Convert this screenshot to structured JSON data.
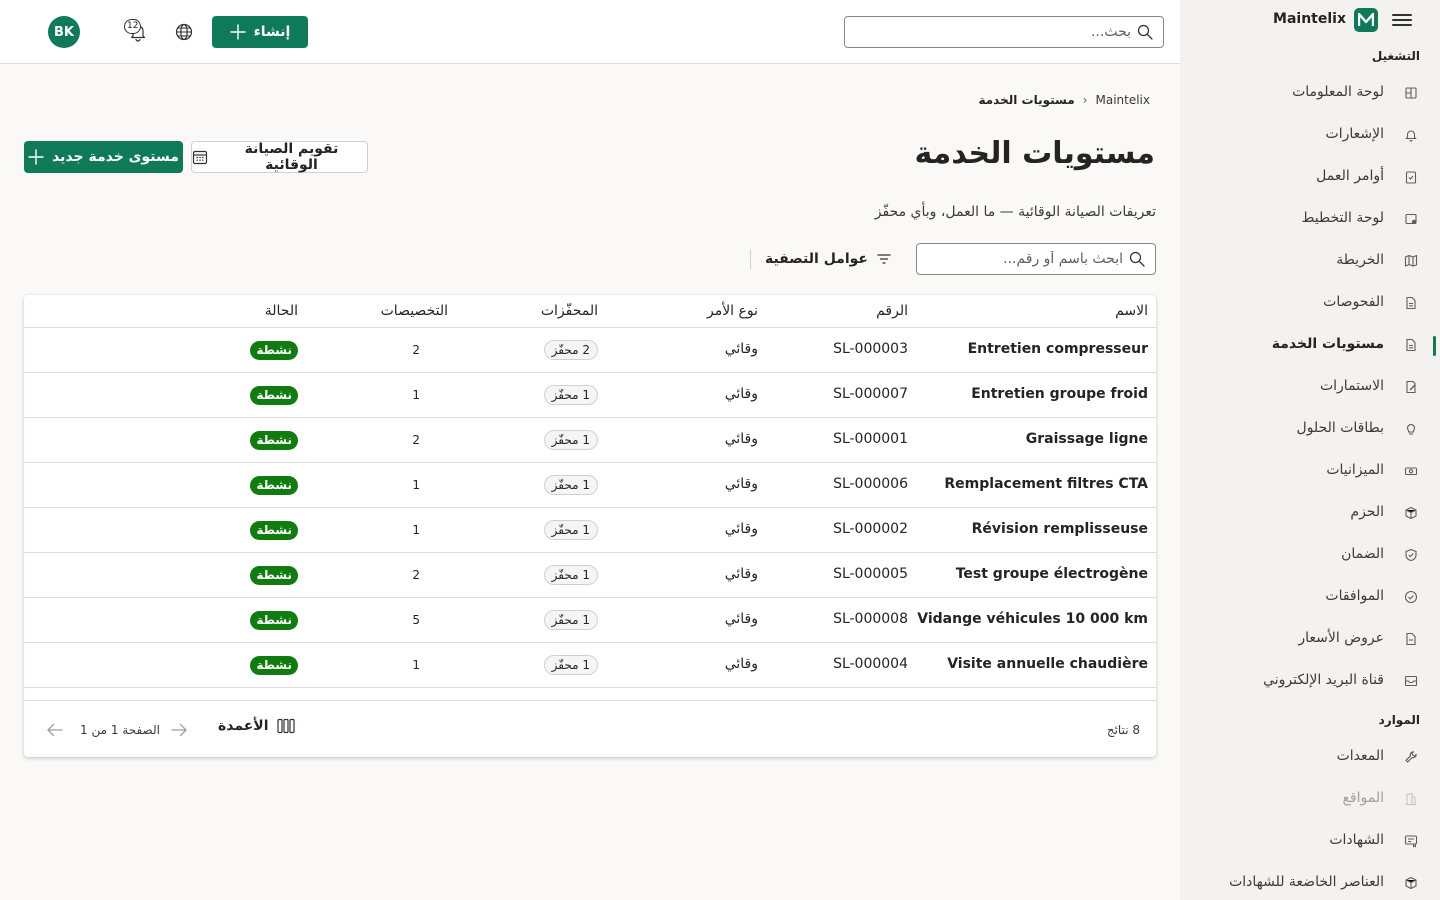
{
  "app": {
    "brand": "Maintelix",
    "logo_letter": "M",
    "accent": "#0e7a57"
  },
  "header": {
    "search_placeholder": "بحث...",
    "create_label": "إنشاء",
    "notifications_count": "12",
    "user_initials": "BK"
  },
  "sidebar": {
    "section_operations": "التشغيل",
    "operations_items": [
      {
        "label": "لوحة المعلومات",
        "icon": "dashboard-icon"
      },
      {
        "label": "الإشعارات",
        "icon": "bell-icon"
      },
      {
        "label": "أوامر العمل",
        "icon": "clipboard-icon"
      },
      {
        "label": "لوحة التخطيط",
        "icon": "planning-icon"
      },
      {
        "label": "الخريطة",
        "icon": "map-icon"
      },
      {
        "label": "الفحوصات",
        "icon": "document-icon"
      },
      {
        "label": "مستويات الخدمة",
        "icon": "document-icon",
        "active": true
      },
      {
        "label": "الاستمارات",
        "icon": "form-icon"
      },
      {
        "label": "بطاقات الحلول",
        "icon": "lightbulb-icon"
      },
      {
        "label": "الميزانيات",
        "icon": "money-icon"
      },
      {
        "label": "الحزم",
        "icon": "box-icon"
      },
      {
        "label": "الضمان",
        "icon": "shield-icon"
      },
      {
        "label": "الموافقات",
        "icon": "check-circle-icon"
      },
      {
        "label": "عروض الأسعار",
        "icon": "quote-icon"
      },
      {
        "label": "قناة البريد الإلكتروني",
        "icon": "mail-icon"
      }
    ],
    "section_resources": "الموارد",
    "resources_items": [
      {
        "label": "المعدات",
        "icon": "wrench-icon"
      },
      {
        "label": "المواقع",
        "icon": "building-icon",
        "disabled": true
      },
      {
        "label": "الشهادات",
        "icon": "certificate-icon"
      },
      {
        "label": "العناصر الخاضعة للشهادات",
        "icon": "box-icon"
      }
    ]
  },
  "breadcrumb": {
    "root": "Maintelix",
    "current": "مستويات الخدمة"
  },
  "page": {
    "title": "مستويات الخدمة",
    "description": "تعريفات الصيانة الوقائية — ما العمل، وبأي محفّز",
    "new_button": "مستوى خدمة جديد",
    "calendar_button": "تقويم الصيانة الوقائية"
  },
  "toolbar": {
    "search_placeholder": "ابحث باسم أو رقم...",
    "filters_label": "عوامل التصفية"
  },
  "table": {
    "headers": {
      "name": "الاسم",
      "number": "الرقم",
      "order_type": "نوع الأمر",
      "triggers": "المحفّزات",
      "assignments": "التخصيصات",
      "status": "الحالة"
    },
    "rows": [
      {
        "name": "Entretien compresseur",
        "number": "SL-000003",
        "order_type": "وقائي",
        "triggers": "2 محفّز",
        "assignments": "2",
        "status": "نشطة"
      },
      {
        "name": "Entretien groupe froid",
        "number": "SL-000007",
        "order_type": "وقائي",
        "triggers": "1 محفّز",
        "assignments": "1",
        "status": "نشطة"
      },
      {
        "name": "Graissage ligne",
        "number": "SL-000001",
        "order_type": "وقائي",
        "triggers": "1 محفّز",
        "assignments": "2",
        "status": "نشطة"
      },
      {
        "name": "Remplacement filtres CTA",
        "number": "SL-000006",
        "order_type": "وقائي",
        "triggers": "1 محفّز",
        "assignments": "1",
        "status": "نشطة"
      },
      {
        "name": "Révision remplisseuse",
        "number": "SL-000002",
        "order_type": "وقائي",
        "triggers": "1 محفّز",
        "assignments": "1",
        "status": "نشطة"
      },
      {
        "name": "Test groupe électrogène",
        "number": "SL-000005",
        "order_type": "وقائي",
        "triggers": "1 محفّز",
        "assignments": "2",
        "status": "نشطة"
      },
      {
        "name": "Vidange véhicules 10 000 km",
        "number": "SL-000008",
        "order_type": "وقائي",
        "triggers": "1 محفّز",
        "assignments": "5",
        "status": "نشطة"
      },
      {
        "name": "Visite annuelle chaudière",
        "number": "SL-000004",
        "order_type": "وقائي",
        "triggers": "1 محفّز",
        "assignments": "1",
        "status": "نشطة"
      }
    ],
    "footer": {
      "results": "8 نتائج",
      "columns_label": "الأعمدة",
      "page_label": "الصفحة 1 من 1"
    }
  },
  "colors": {
    "status_active": "#107c10",
    "border": "#e1dfdd"
  }
}
